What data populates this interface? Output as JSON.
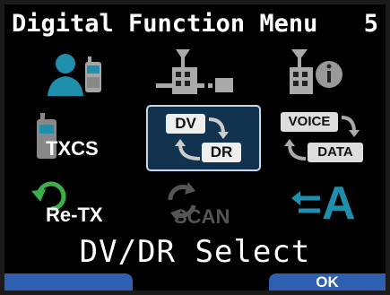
{
  "header": {
    "title": "Digital Function Menu",
    "page": "5"
  },
  "menu": [
    {
      "icon": "user-radio-icon",
      "label": ""
    },
    {
      "icon": "repeater-connection-icon",
      "label": ""
    },
    {
      "icon": "repeater-info-icon",
      "label": ""
    },
    {
      "icon": "txcs-icon",
      "label": "TXCS"
    },
    {
      "icon": "dv-dr-icon",
      "label_top": "DV",
      "label_bottom": "DR"
    },
    {
      "icon": "voice-data-icon",
      "label_top": "VOICE",
      "label_bottom": "DATA"
    },
    {
      "icon": "re-tx-icon",
      "label": "Re-TX"
    },
    {
      "icon": "scan-icon",
      "label": "SCAN"
    },
    {
      "icon": "text-input-icon",
      "label": "A"
    }
  ],
  "status": {
    "text": "DV/DR Select"
  },
  "softkeys": {
    "left": "",
    "right": "OK"
  },
  "colors": {
    "accent": "#2f5fb0",
    "selected_bg": "#12334f",
    "teal": "#1f8fae",
    "green": "#3caf4a"
  }
}
